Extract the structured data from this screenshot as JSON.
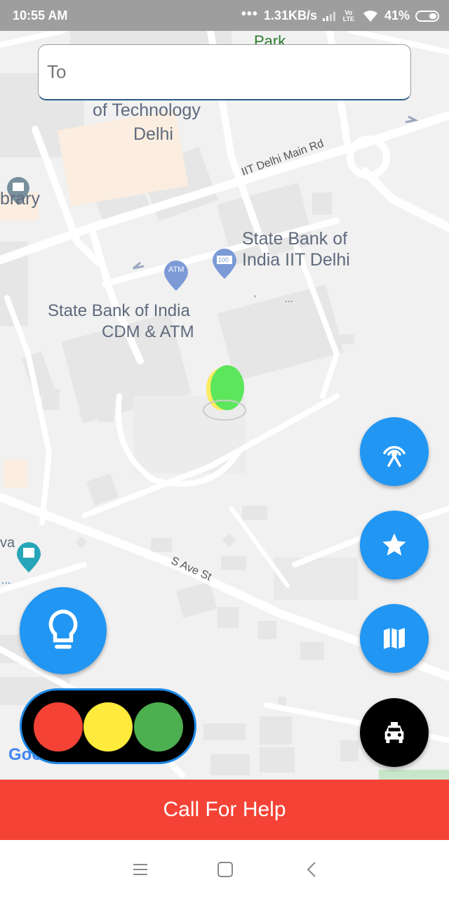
{
  "status_bar": {
    "time": "10:55 AM",
    "dots": "•••",
    "network_speed": "1.31KB/s",
    "volte": "Vo LTE",
    "battery": "41%"
  },
  "search": {
    "placeholder": "To"
  },
  "map": {
    "labels": {
      "park": "Park",
      "iit_line1": "of Technology",
      "iit_line2": "Delhi",
      "library": "brary",
      "road_main": "IIT Delhi Main Rd",
      "sbi_line1": "State Bank of",
      "sbi_line2": "India IIT Delhi",
      "atm_line1": "State Bank of India",
      "atm_line2": "CDM & ATM",
      "road_save": "S Ave St",
      "left_partial": "va",
      "dots1": "...",
      "dots2": "...",
      "dots3": "'",
      "google": "Goo"
    },
    "pins": {
      "atm_text": "ATM",
      "bank_text": "100"
    },
    "colors": {
      "land": "#f1f1f1",
      "road": "#ffffff",
      "building": "#e8e8e8",
      "label": "#5f6a7d",
      "pin_blue": "#7b9ad6",
      "pin_teal": "#26a6b8"
    }
  },
  "fabs": {
    "signal": "signal-tower-icon",
    "favorite": "star-icon",
    "map": "map-icon",
    "taxi": "taxi-icon",
    "idea": "lightbulb-icon"
  },
  "traffic_light": {
    "red": "#f44336",
    "yellow": "#ffeb3b",
    "green": "#4caf50"
  },
  "call_for_help": {
    "label": "Call For Help",
    "color": "#f44336"
  },
  "nav_bar": {
    "menu": "menu-icon",
    "home": "home-icon",
    "back": "back-icon"
  }
}
